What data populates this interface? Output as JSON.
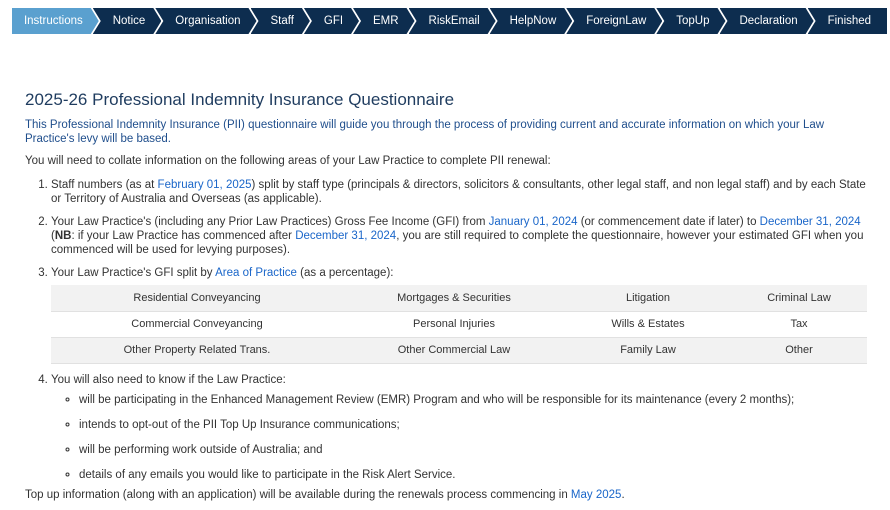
{
  "wizard": {
    "steps": [
      "Instructions",
      "Notice",
      "Organisation",
      "Staff",
      "GFI",
      "EMR",
      "RiskEmail",
      "HelpNow",
      "ForeignLaw",
      "TopUp",
      "Declaration",
      "Finished"
    ],
    "active_index": 0
  },
  "page": {
    "title": "2025-26 Professional Indemnity Insurance Questionnaire",
    "intro": "This Professional Indemnity Insurance (PII) questionnaire will guide you through the process of providing current and accurate information on which your Law Practice's levy will be based.",
    "lead": "You will need to collate information on the following areas of your Law Practice to complete PII renewal:"
  },
  "items": {
    "i1": {
      "a": "Staff numbers (as at ",
      "link": "February 01, 2025",
      "b": ") split by staff type (principals & directors, solicitors & consultants, other legal staff, and non legal staff) and by each State or Territory of Australia and Overseas (as applicable)."
    },
    "i2": {
      "a": "Your Law Practice's (including any Prior Law Practices) Gross Fee Income (GFI) from ",
      "link1": "January 01, 2024",
      "b": " (or commencement date if later) to ",
      "link2": "December 31, 2024",
      "c": " (",
      "nb": "NB",
      "d": ": if your Law Practice has commenced after ",
      "link3": "December 31, 2024",
      "e": ", you are still required to complete the questionnaire, however your estimated GFI when you commenced will be used for levying purposes)."
    },
    "i3": {
      "a": "Your Law Practice's GFI split by ",
      "link": "Area of Practice",
      "b": " (as a percentage):"
    },
    "areas": [
      [
        "Residential Conveyancing",
        "Mortgages & Securities",
        "Litigation",
        "Criminal Law"
      ],
      [
        "Commercial Conveyancing",
        "Personal Injuries",
        "Wills & Estates",
        "Tax"
      ],
      [
        "Other Property Related Trans.",
        "Other Commercial Law",
        "Family Law",
        "Other"
      ]
    ],
    "i4": {
      "a": "You will also need to know if the Law Practice:",
      "bullets": [
        "will be participating in the Enhanced Management Review (EMR) Program and who will be responsible for its maintenance (every 2 months);",
        "intends to opt-out of the PII Top Up Insurance communications;",
        "will be performing work outside of Australia; and",
        "details of any emails you would like to participate in the Risk Alert Service."
      ]
    }
  },
  "footer": {
    "a": "Top up information (along with an application) will be available during the renewals process commencing in ",
    "link": "May 2025",
    "b": "."
  },
  "colors": {
    "wizard_bg": "#0d2d4f",
    "wizard_active": "#5aa0cf",
    "link": "#1a66c9",
    "title": "#1f3c5f"
  }
}
